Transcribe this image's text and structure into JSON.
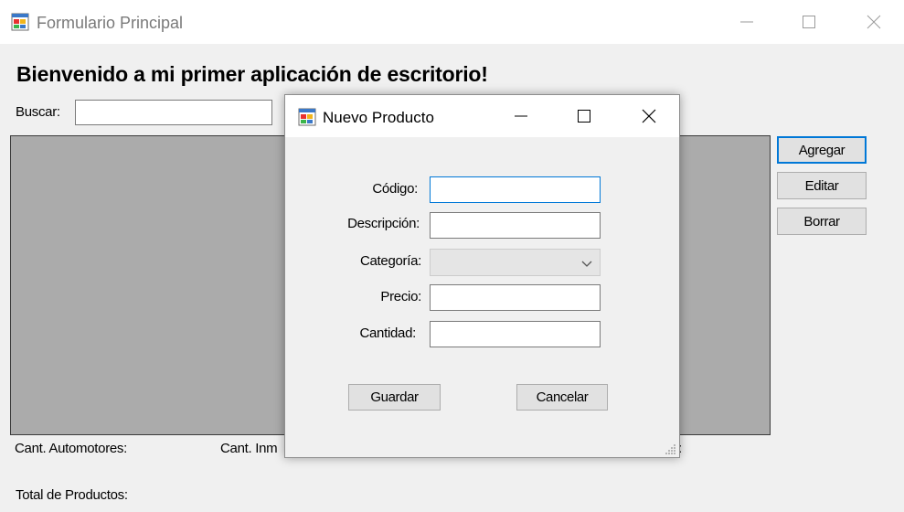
{
  "main_window": {
    "title": "Formulario Principal",
    "welcome": "Bienvenido a mi primer aplicación de escritorio!",
    "search_label": "Buscar:",
    "search_value": "",
    "buttons": {
      "add": "Agregar",
      "edit": "Editar",
      "delete": "Borrar"
    },
    "footer": {
      "automotores": "Cant. Automotores:",
      "inmuebles": "Cant. Inm",
      "otros": ":",
      "total": "Total de Productos:"
    }
  },
  "dialog": {
    "title": "Nuevo Producto",
    "fields": {
      "code": {
        "label": "Código:",
        "value": ""
      },
      "description": {
        "label": "Descripción:",
        "value": ""
      },
      "category": {
        "label": "Categoría:",
        "value": ""
      },
      "price": {
        "label": "Precio:",
        "value": ""
      },
      "quantity": {
        "label": "Cantidad:",
        "value": ""
      }
    },
    "buttons": {
      "save": "Guardar",
      "cancel": "Cancelar"
    }
  },
  "icons": {
    "app": "app-form-icon",
    "minimize": "minimize-icon",
    "maximize": "maximize-icon",
    "close": "close-icon",
    "dropdown": "chevron-down-icon",
    "resize": "resize-grip-icon"
  },
  "colors": {
    "focus_border": "#0078d7",
    "grid_background": "#ababab",
    "window_background": "#f0f0f0"
  }
}
